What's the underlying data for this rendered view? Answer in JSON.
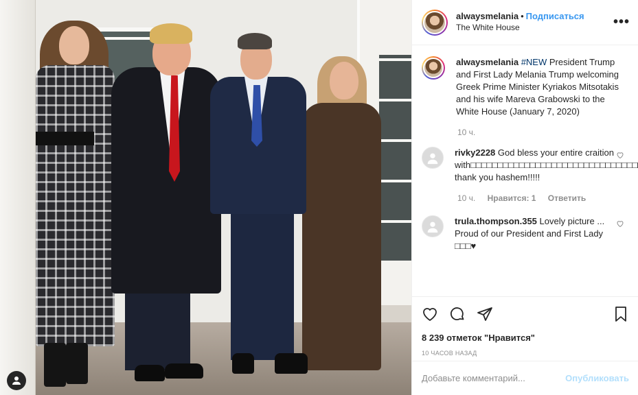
{
  "post": {
    "username": "alwaysmelania",
    "follow_label": "Подписаться",
    "dot": "•",
    "location": "The White House",
    "more_label": "•••"
  },
  "caption": {
    "username": "alwaysmelania",
    "hashtag": "#NEW",
    "text": " President Trump and First Lady Melania Trump welcoming Greek Prime Minister Kyriakos Mitsotakis and his wife Mareva Grabowski to the White House (January 7, 2020)",
    "time": "10 ч."
  },
  "comments": [
    {
      "username": "rivky2228",
      "text": " God bless your entire craition with□□□□□□□□□□□□□□□□□□□□□□□□□□□□□□□□□□□ thank you hashem!!!!!",
      "time": "10 ч.",
      "likes": "Нравится: 1",
      "reply": "Ответить"
    },
    {
      "username": "trula.thompson.355",
      "text": " Lovely picture ... Proud of our President and First Lady □□□♥",
      "time": "",
      "likes": "",
      "reply": ""
    }
  ],
  "likes_text": "8 239 отметок \"Нравится\"",
  "time_ago": "10 часов назад",
  "add_comment": {
    "placeholder": "Добавьте комментарий...",
    "post_label": "Опубликовать"
  },
  "icons": {
    "like": "heart-icon",
    "comment": "comment-icon",
    "share": "share-icon",
    "save": "bookmark-icon",
    "user": "user-icon"
  },
  "colors": {
    "link": "#3897f0",
    "hashtag": "#003569",
    "muted": "#8e8e8e",
    "post_disabled": "#b2dffc"
  }
}
